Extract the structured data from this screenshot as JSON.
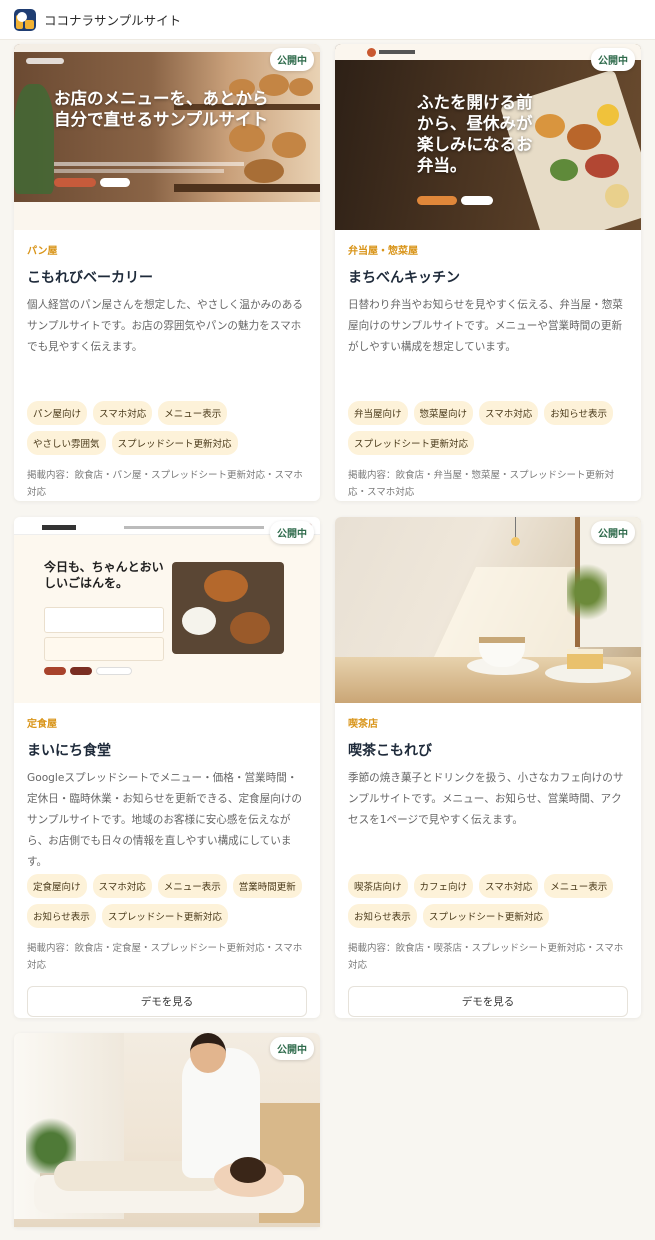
{
  "site": {
    "title": "ココナラサンプルサイト"
  },
  "status_label": "公開中",
  "demo_label": "デモを見る",
  "cards": [
    {
      "category": "パン屋",
      "title": "こもれびベーカリー",
      "description": "個人経営のパン屋さんを想定した、やさしく温かみのあるサンプルサイトです。お店の雰囲気やパンの魅力をスマホでも見やすく伝えます。",
      "tags": [
        "パン屋向け",
        "スマホ対応",
        "メニュー表示",
        "やさしい雰囲気",
        "スプレッドシート更新対応"
      ],
      "meta": "掲載内容：飲食店・パン屋・スプレッドシート更新対応・スマホ対応",
      "preview_heading": "お店のメニューを、あとから自分で直せるサンプルサイト"
    },
    {
      "category": "弁当屋・惣菜屋",
      "title": "まちべんキッチン",
      "description": "日替わり弁当やお知らせを見やすく伝える、弁当屋・惣菜屋向けのサンプルサイトです。メニューや営業時間の更新がしやすい構成を想定しています。",
      "tags": [
        "弁当屋向け",
        "惣菜屋向け",
        "スマホ対応",
        "お知らせ表示",
        "スプレッドシート更新対応"
      ],
      "meta": "掲載内容：飲食店・弁当屋・惣菜屋・スプレッドシート更新対応・スマホ対応",
      "preview_heading": "ふたを開ける前から、昼休みが楽しみになるお弁当。"
    },
    {
      "category": "定食屋",
      "title": "まいにち食堂",
      "description": "Googleスプレッドシートでメニュー・価格・営業時間・定休日・臨時休業・お知らせを更新できる、定食屋向けのサンプルサイトです。地域のお客様に安心感を伝えながら、お店側でも日々の情報を直しやすい構成にしています。",
      "tags": [
        "定食屋向け",
        "スマホ対応",
        "メニュー表示",
        "営業時間更新",
        "お知らせ表示",
        "スプレッドシート更新対応"
      ],
      "meta": "掲載内容：飲食店・定食屋・スプレッドシート更新対応・スマホ対応",
      "preview_heading": "今日も、ちゃんとおいしいごはんを。"
    },
    {
      "category": "喫茶店",
      "title": "喫茶こもれび",
      "description": "季節の焼き菓子とドリンクを扱う、小さなカフェ向けのサンプルサイトです。メニュー、お知らせ、営業時間、アクセスを1ページで見やすく伝えます。",
      "tags": [
        "喫茶店向け",
        "カフェ向け",
        "スマホ対応",
        "メニュー表示",
        "お知らせ表示",
        "スプレッドシート更新対応"
      ],
      "meta": "掲載内容：飲食店・喫茶店・スプレッドシート更新対応・スマホ対応"
    },
    {}
  ]
}
